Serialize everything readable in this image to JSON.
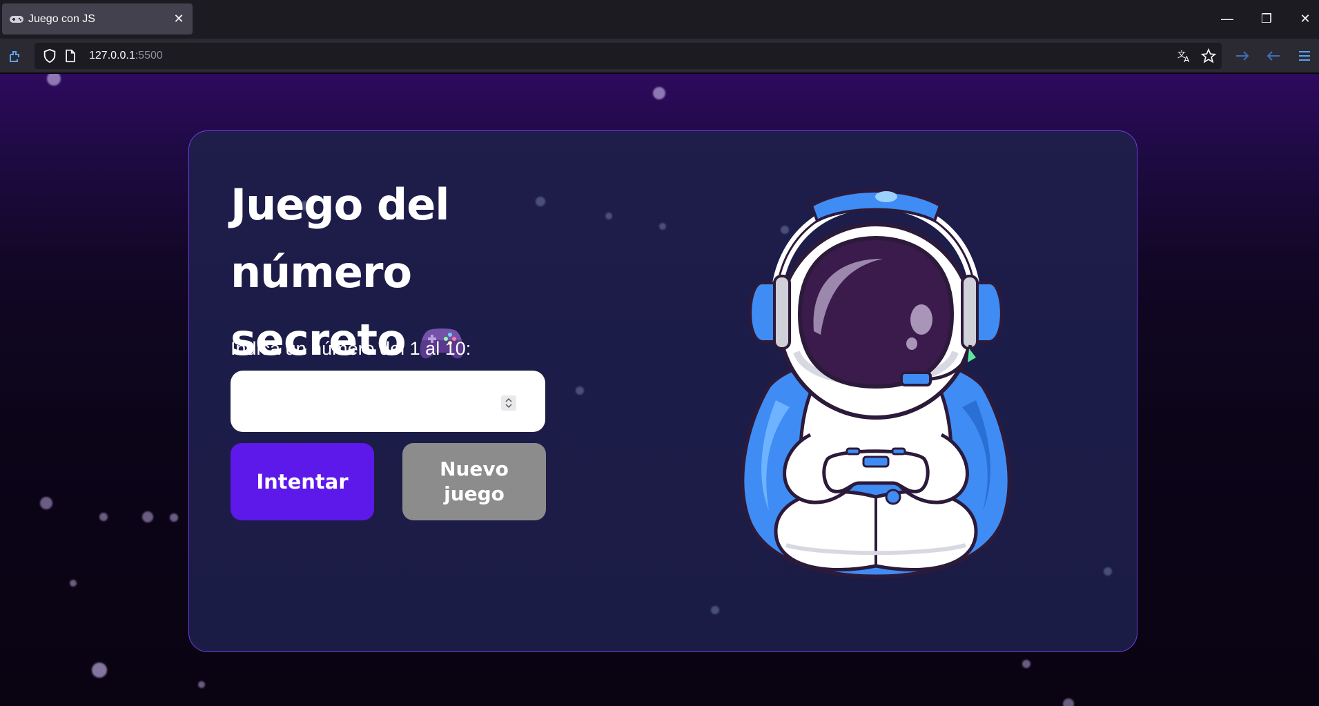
{
  "browser": {
    "tab_title": "Juego con JS",
    "url_host": "127.0.0.1",
    "url_port": ":5500"
  },
  "card": {
    "title_lines": [
      "Juego del",
      "número",
      "secreto"
    ],
    "prompt": "Indica un número del 1 al 10:",
    "input_value": "",
    "try_button": "Intentar",
    "new_game_button": "Nuevo juego"
  },
  "colors": {
    "primary_button": "#5d18ea",
    "secondary_button": "#8c8c8c",
    "card_border": "#6d3fe0"
  }
}
